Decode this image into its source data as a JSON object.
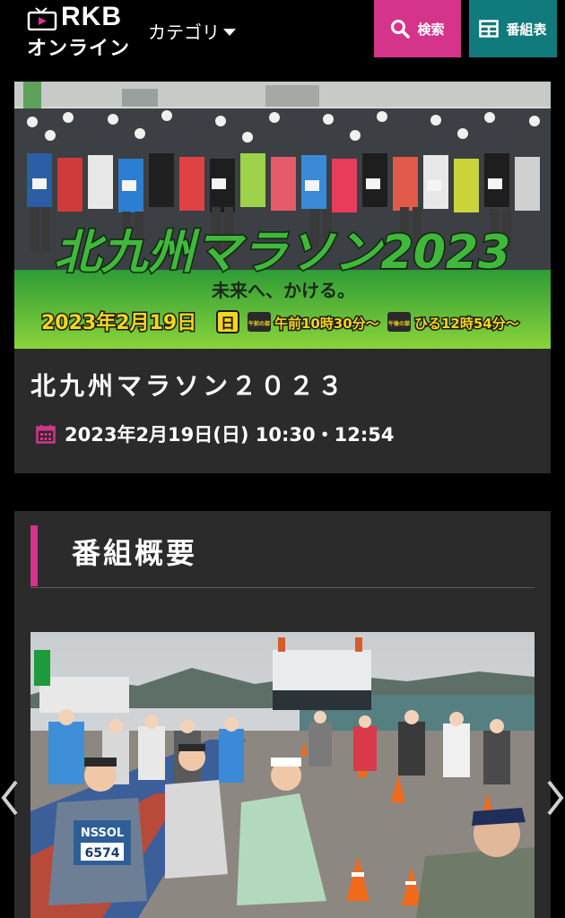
{
  "header": {
    "logo_top": "RKB",
    "logo_bottom": "オンライン",
    "category_label": "カテゴリ",
    "search_label": "検索",
    "schedule_label": "番組表"
  },
  "program": {
    "banner_title": "北九州マラソン2023",
    "banner_tagline": "未来へ、かける。",
    "banner_date": "2023年2月19日",
    "banner_weekday": "日",
    "banner_time1_tag": "午前の部",
    "banner_time1": "午前10時30分～",
    "banner_time2_tag": "午後の部",
    "banner_time2": "ひる12時54分～",
    "title": "北九州マラソン２０２３",
    "datetime": "2023年2月19日(日) 10:30・12:54"
  },
  "overview": {
    "heading": "番組概要",
    "photo_bib": "NSSOL",
    "photo_bib_no": "6574"
  },
  "colors": {
    "accent_pink": "#d4348a",
    "accent_teal": "#117a7c",
    "card_bg": "#2b2b2b",
    "banner_green": "#3aa832",
    "banner_yellow": "#f6d51c"
  }
}
